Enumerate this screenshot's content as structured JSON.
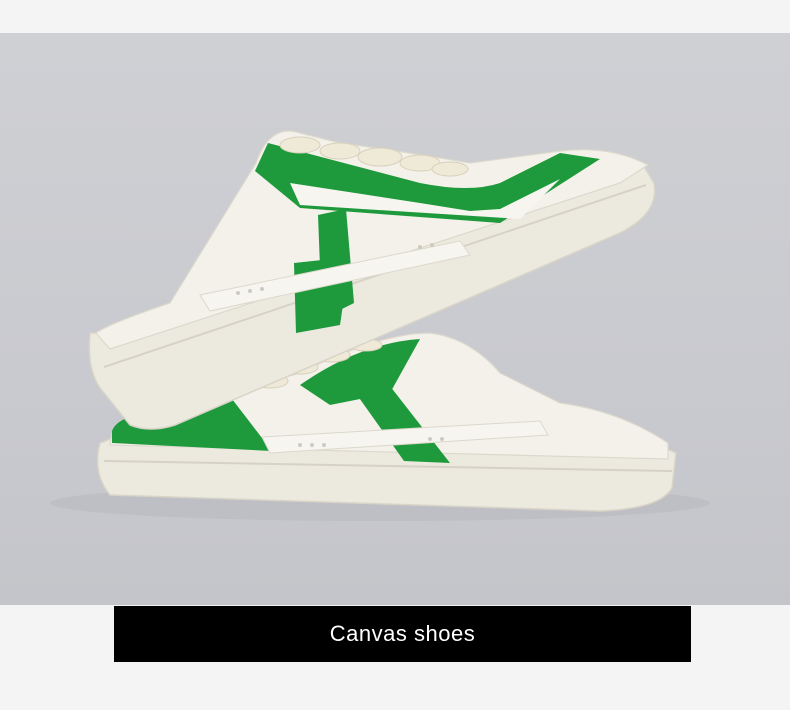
{
  "product_image": {
    "alt": "",
    "accent_color": "#1e9a3c",
    "base_color": "#f2f0e8",
    "backdrop_color": "#cbccd1"
  },
  "caption": {
    "text": "Canvas shoes"
  }
}
